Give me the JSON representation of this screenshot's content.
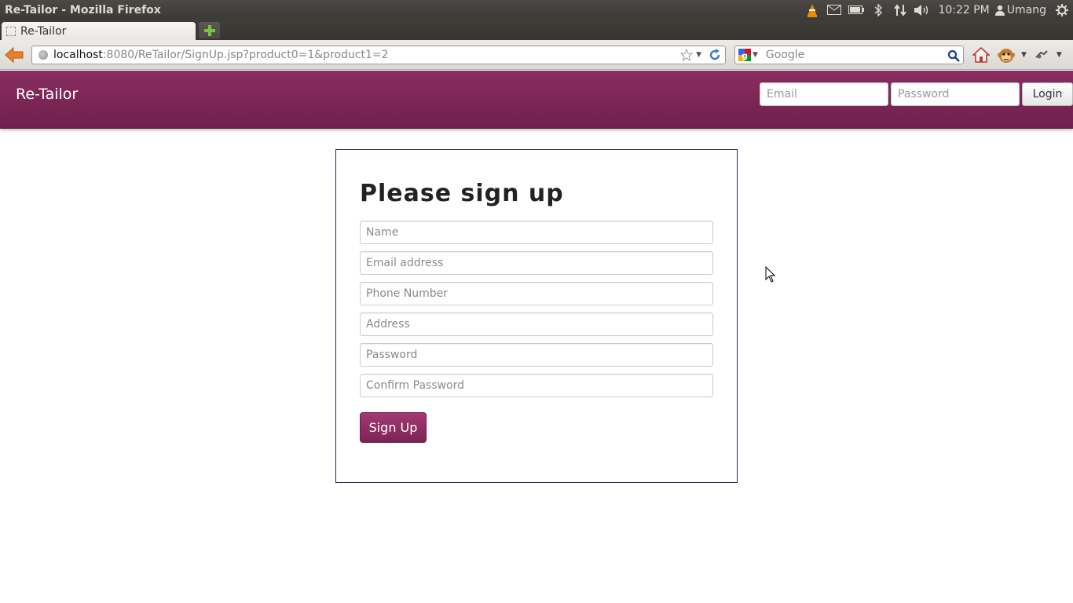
{
  "os": {
    "window_title": "Re-Tailor - Mozilla Firefox",
    "clock": "10:22 PM",
    "user_name": "Umang"
  },
  "browser": {
    "tab_title": "Re-Tailor",
    "url_host": "localhost",
    "url_rest": ":8080/ReTailor/SignUp.jsp?product0=1&product1=2",
    "search_placeholder": "Google"
  },
  "site_nav": {
    "brand": "Re-Tailor",
    "email_placeholder": "Email",
    "password_placeholder": "Password",
    "login_label": "Login"
  },
  "signup_form": {
    "heading": "Please sign up",
    "fields": {
      "name": "Name",
      "email": "Email address",
      "phone": "Phone Number",
      "address": "Address",
      "password": "Password",
      "confirm_password": "Confirm Password"
    },
    "submit_label": "Sign Up"
  },
  "colors": {
    "brand_primary": "#892e61",
    "brand_dark": "#6f1f4c",
    "form_border": "#1d2a4c"
  },
  "icons": {
    "tray": [
      "vlc-icon",
      "mail-icon",
      "battery-icon",
      "bluetooth-icon",
      "network-icon",
      "volume-icon",
      "user-icon",
      "power-gear-icon"
    ],
    "toolbar": [
      "back-arrow-icon",
      "site-identity-icon",
      "bookmark-star-icon",
      "reload-icon",
      "google-engine-icon",
      "search-magnifier-icon",
      "home-icon",
      "greasemonkey-icon",
      "addon-icon"
    ]
  }
}
